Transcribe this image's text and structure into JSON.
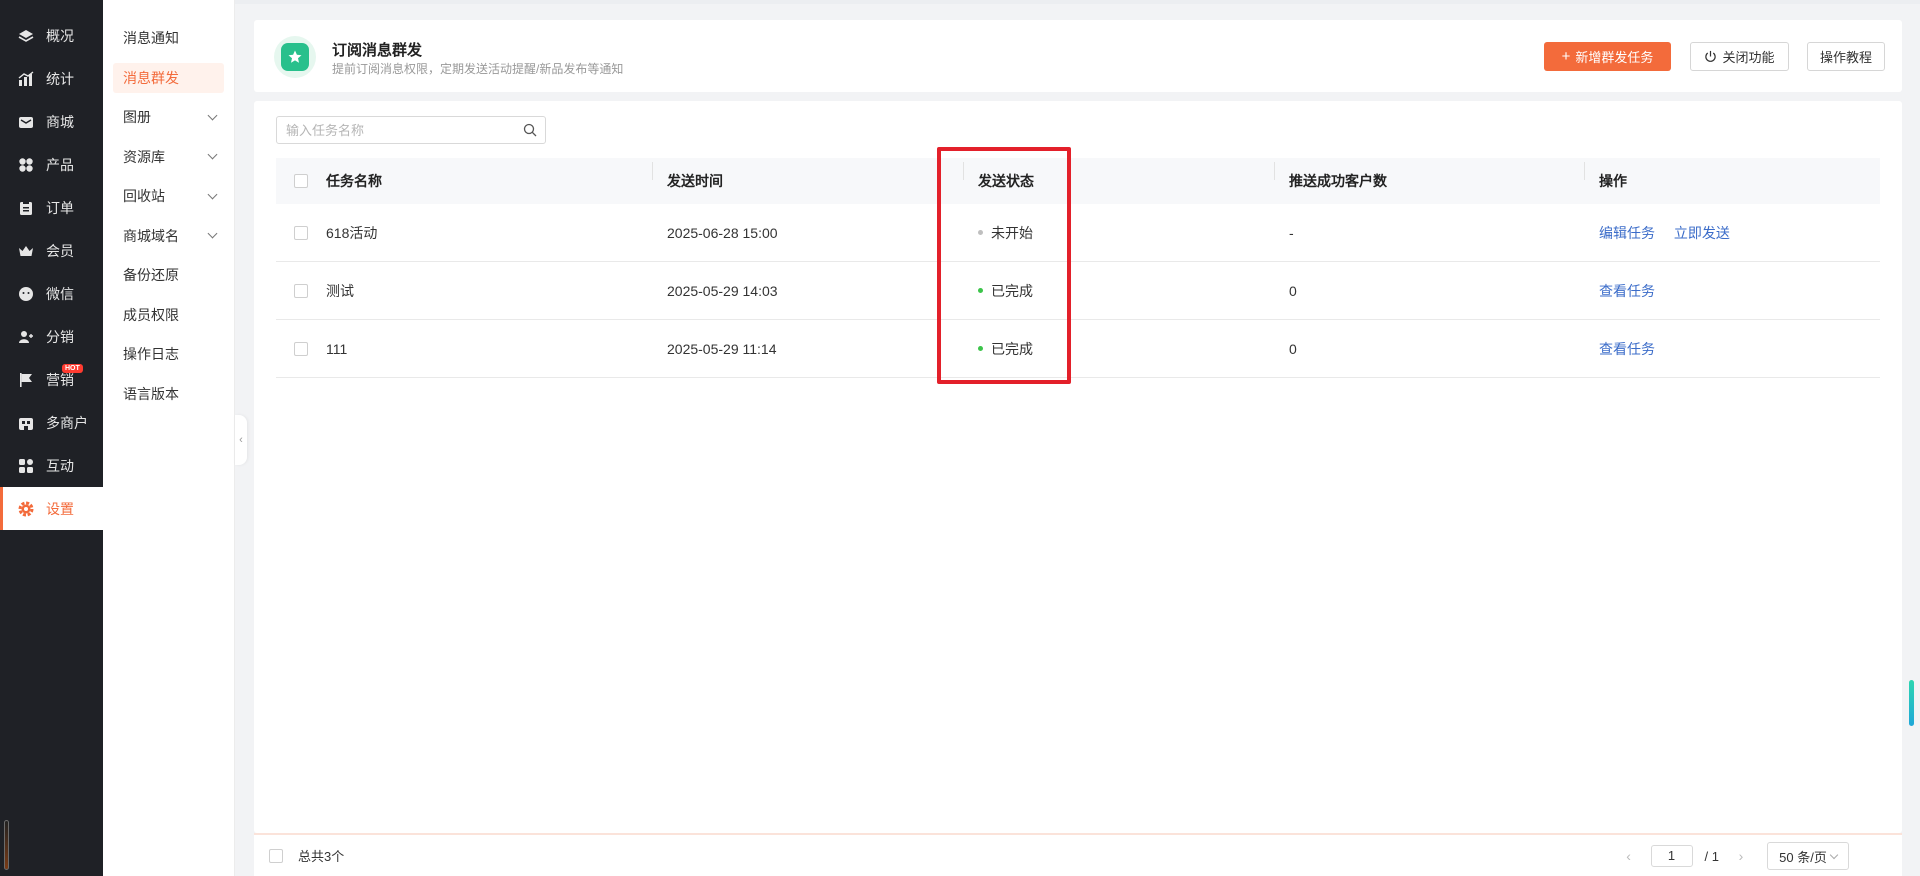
{
  "left_rail": {
    "items": [
      {
        "label": "概况",
        "icon": "layers-icon"
      },
      {
        "label": "统计",
        "icon": "chart-icon"
      },
      {
        "label": "商城",
        "icon": "mail-icon"
      },
      {
        "label": "产品",
        "icon": "grid-icon"
      },
      {
        "label": "订单",
        "icon": "clipboard-icon"
      },
      {
        "label": "会员",
        "icon": "crown-icon"
      },
      {
        "label": "微信",
        "icon": "wechat-icon"
      },
      {
        "label": "分销",
        "icon": "users-icon"
      },
      {
        "label": "营销",
        "icon": "flag-icon",
        "badge": "HOT"
      },
      {
        "label": "多商户",
        "icon": "store-icon"
      },
      {
        "label": "互动",
        "icon": "apps-icon"
      },
      {
        "label": "设置",
        "icon": "gear-icon",
        "active": true
      }
    ]
  },
  "sub_menu": {
    "items": [
      {
        "label": "消息通知"
      },
      {
        "label": "消息群发",
        "active": true
      },
      {
        "label": "图册",
        "expandable": true
      },
      {
        "label": "资源库",
        "expandable": true
      },
      {
        "label": "回收站",
        "expandable": true
      },
      {
        "label": "商城域名",
        "expandable": true
      },
      {
        "label": "备份还原"
      },
      {
        "label": "成员权限"
      },
      {
        "label": "操作日志"
      },
      {
        "label": "语言版本"
      }
    ]
  },
  "header": {
    "title": "订阅消息群发",
    "subtitle": "提前订阅消息权限，定期发送活动提醒/新品发布等通知",
    "new_task_button": "新增群发任务",
    "close_button": "关闭功能",
    "tutorial_button": "操作教程"
  },
  "search": {
    "placeholder": "输入任务名称",
    "value": ""
  },
  "table": {
    "columns": [
      "任务名称",
      "发送时间",
      "发送状态",
      "推送成功客户数",
      "操作"
    ],
    "rows": [
      {
        "name": "618活动",
        "time": "2025-06-28 15:00",
        "status": "未开始",
        "status_color": "#bfbfbf",
        "count": "-",
        "actions": [
          "编辑任务",
          "立即发送"
        ]
      },
      {
        "name": "测试",
        "time": "2025-05-29 14:03",
        "status": "已完成",
        "status_color": "#3cc44a",
        "count": "0",
        "actions": [
          "查看任务"
        ]
      },
      {
        "name": "111",
        "time": "2025-05-29 11:14",
        "status": "已完成",
        "status_color": "#3cc44a",
        "count": "0",
        "actions": [
          "查看任务"
        ]
      }
    ]
  },
  "footer": {
    "total": "总共3个",
    "current_page": "1",
    "page_total": "/ 1",
    "page_size": "50 条/页"
  },
  "colors": {
    "accent": "#f36b3b",
    "link": "#3b6cc9",
    "highlight": "#e3202a",
    "rail_bg": "#1f2126"
  }
}
